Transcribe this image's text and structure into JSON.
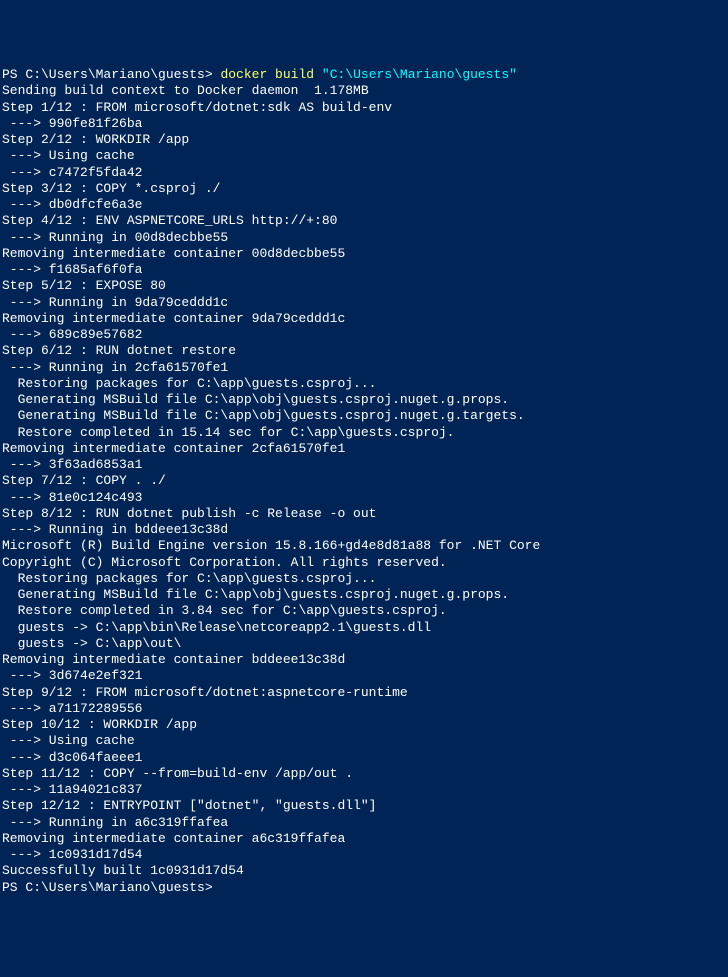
{
  "prompt": "PS C:\\Users\\Mariano\\guests>",
  "command": "docker build",
  "path": "\"C:\\Users\\Mariano\\guests\"",
  "lines": [
    "Sending build context to Docker daemon  1.178MB",
    "Step 1/12 : FROM microsoft/dotnet:sdk AS build-env",
    " ---> 990fe81f26ba",
    "Step 2/12 : WORKDIR /app",
    " ---> Using cache",
    " ---> c7472f5fda42",
    "Step 3/12 : COPY *.csproj ./",
    " ---> db0dfcfe6a3e",
    "Step 4/12 : ENV ASPNETCORE_URLS http://+:80",
    " ---> Running in 00d8decbbe55",
    "Removing intermediate container 00d8decbbe55",
    " ---> f1685af6f0fa",
    "Step 5/12 : EXPOSE 80",
    " ---> Running in 9da79ceddd1c",
    "Removing intermediate container 9da79ceddd1c",
    " ---> 689c89e57682",
    "Step 6/12 : RUN dotnet restore",
    " ---> Running in 2cfa61570fe1",
    "  Restoring packages for C:\\app\\guests.csproj...",
    "  Generating MSBuild file C:\\app\\obj\\guests.csproj.nuget.g.props.",
    "  Generating MSBuild file C:\\app\\obj\\guests.csproj.nuget.g.targets.",
    "  Restore completed in 15.14 sec for C:\\app\\guests.csproj.",
    "Removing intermediate container 2cfa61570fe1",
    " ---> 3f63ad6853a1",
    "Step 7/12 : COPY . ./",
    " ---> 81e0c124c493",
    "Step 8/12 : RUN dotnet publish -c Release -o out",
    " ---> Running in bddeee13c38d",
    "Microsoft (R) Build Engine version 15.8.166+gd4e8d81a88 for .NET Core",
    "Copyright (C) Microsoft Corporation. All rights reserved.",
    "",
    "  Restoring packages for C:\\app\\guests.csproj...",
    "  Generating MSBuild file C:\\app\\obj\\guests.csproj.nuget.g.props.",
    "  Restore completed in 3.84 sec for C:\\app\\guests.csproj.",
    "  guests -> C:\\app\\bin\\Release\\netcoreapp2.1\\guests.dll",
    "  guests -> C:\\app\\out\\",
    "Removing intermediate container bddeee13c38d",
    " ---> 3d674e2ef321",
    "Step 9/12 : FROM microsoft/dotnet:aspnetcore-runtime",
    " ---> a71172289556",
    "Step 10/12 : WORKDIR /app",
    " ---> Using cache",
    " ---> d3c064faeee1",
    "Step 11/12 : COPY --from=build-env /app/out .",
    " ---> 11a94021c837",
    "Step 12/12 : ENTRYPOINT [\"dotnet\", \"guests.dll\"]",
    " ---> Running in a6c319ffafea",
    "Removing intermediate container a6c319ffafea",
    " ---> 1c0931d17d54",
    "Successfully built 1c0931d17d54"
  ],
  "prompt_end": "PS C:\\Users\\Mariano\\guests>"
}
